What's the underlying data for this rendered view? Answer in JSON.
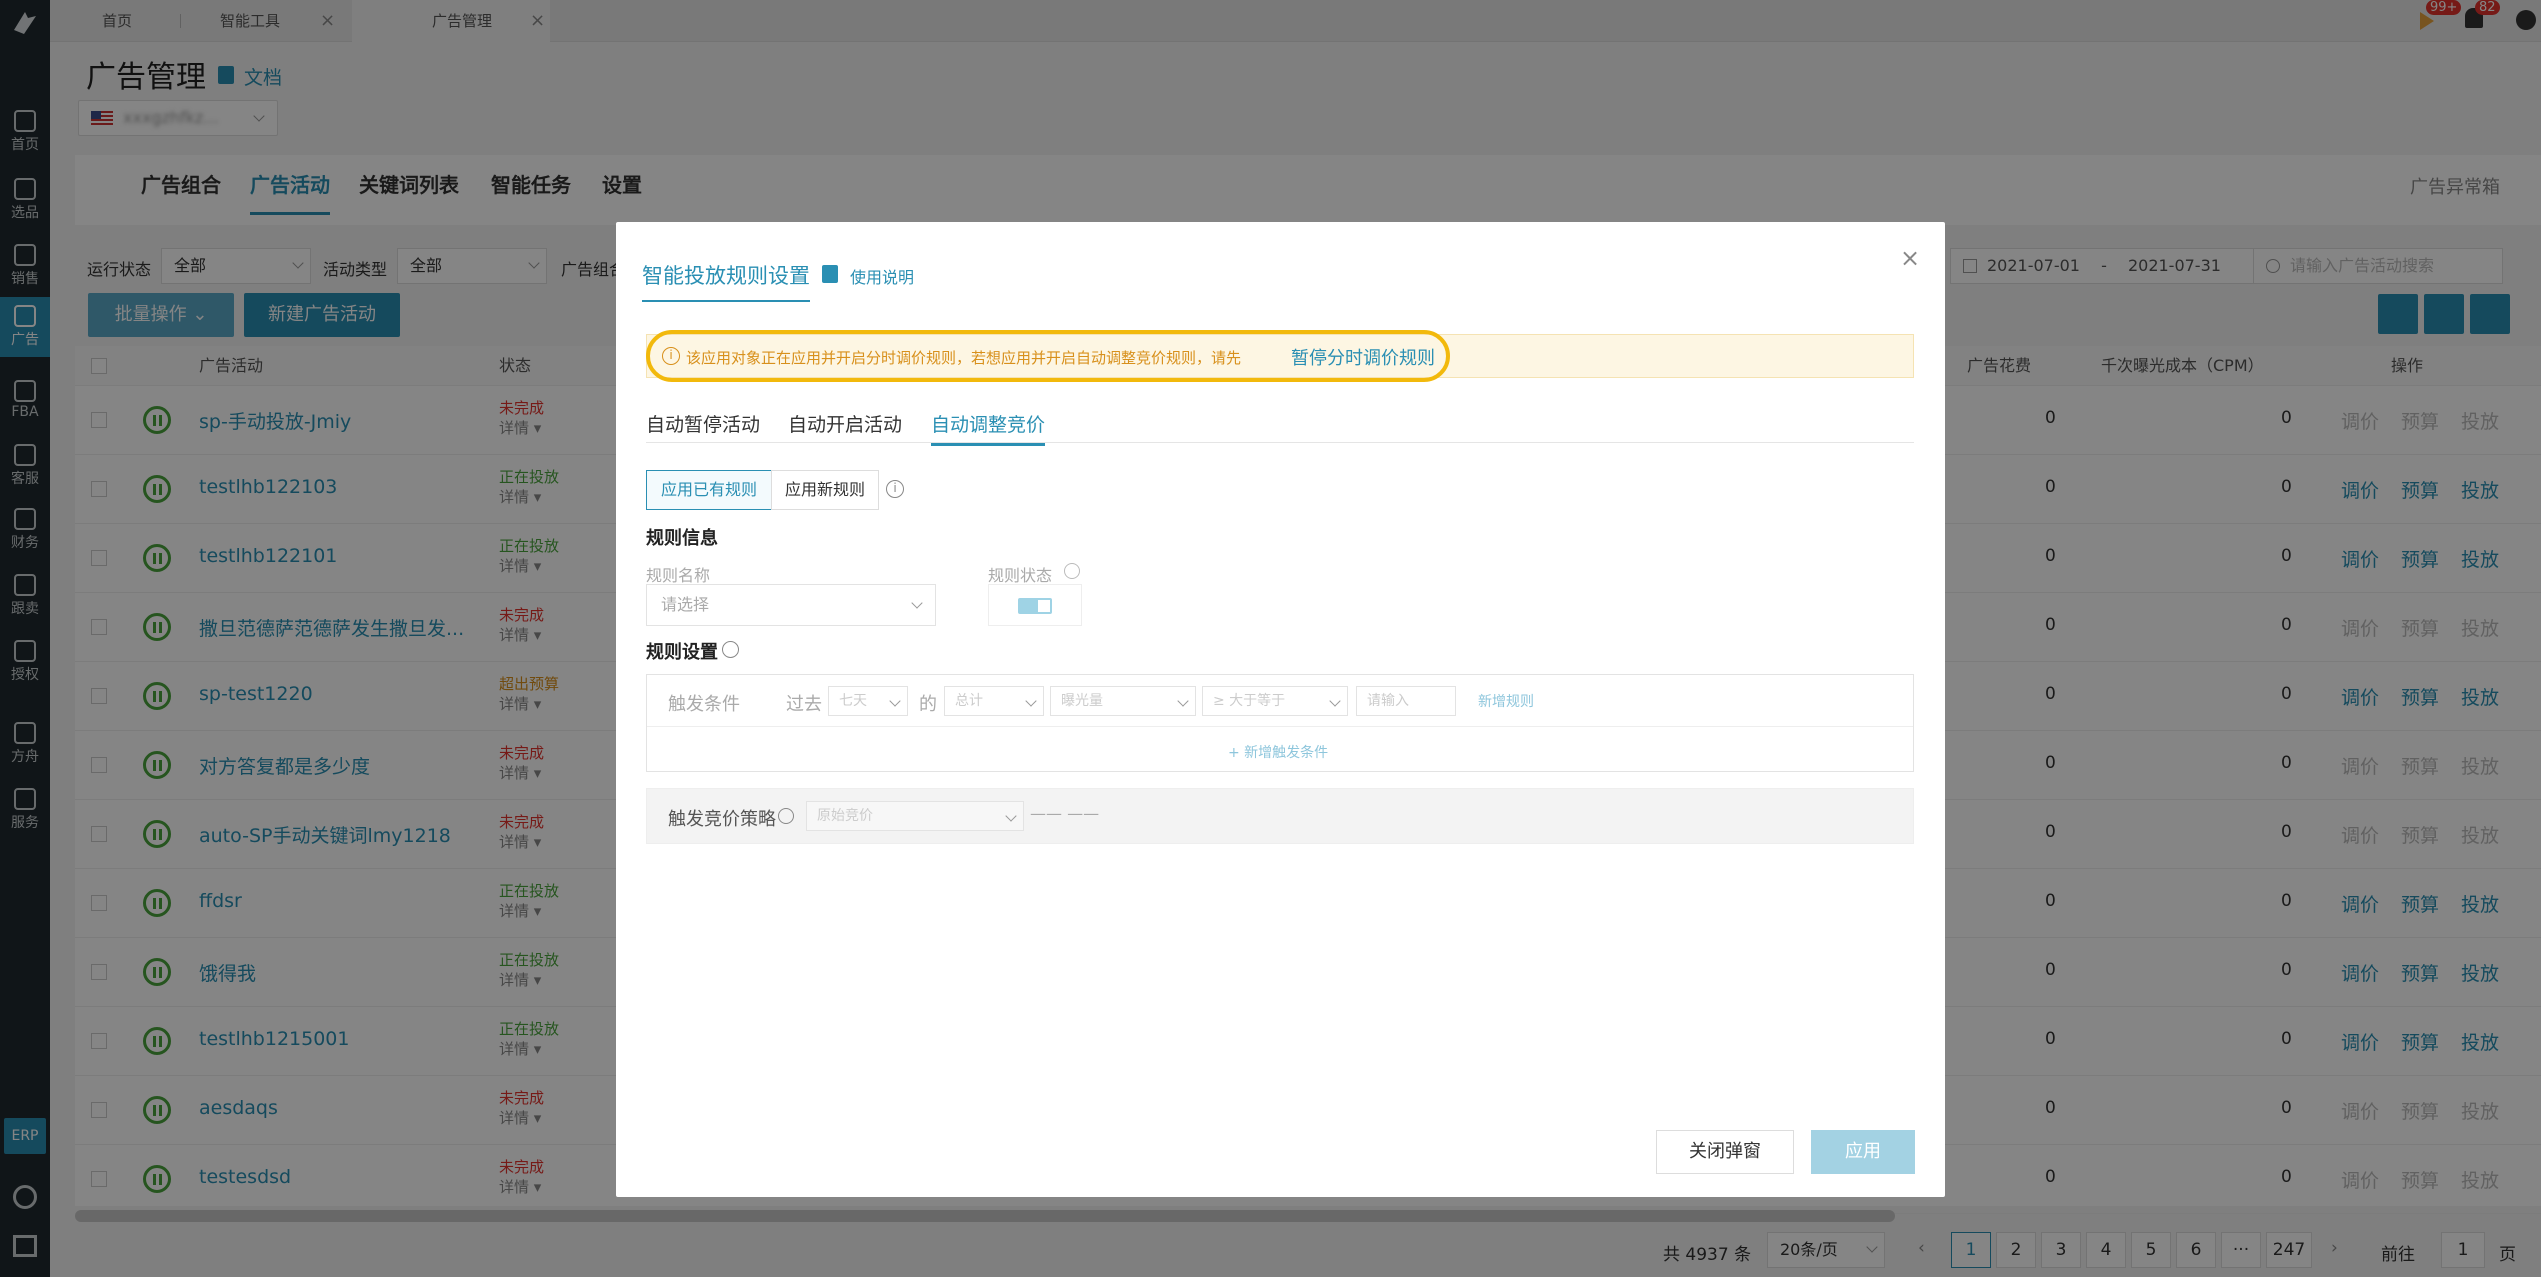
{
  "sidebar": {
    "items": [
      {
        "label": "首页",
        "icon": "home-icon"
      },
      {
        "label": "选品",
        "icon": "search-icon"
      },
      {
        "label": "销售",
        "icon": "chart-line-icon"
      },
      {
        "label": "广告",
        "icon": "ad-icon"
      },
      {
        "label": "FBA",
        "icon": "box-icon"
      },
      {
        "label": "客服",
        "icon": "chart-bar-icon"
      },
      {
        "label": "财务",
        "icon": "dollar-icon"
      },
      {
        "label": "跟卖",
        "icon": "pie-icon"
      },
      {
        "label": "授权",
        "icon": "shield-icon"
      },
      {
        "label": "方舟",
        "icon": "ark-icon"
      },
      {
        "label": "服务",
        "icon": "briefcase-icon"
      }
    ],
    "erp_label": "ERP"
  },
  "tabs": [
    "首页",
    "智能工具",
    "广告管理"
  ],
  "header": {
    "notification_badge_1": "99+",
    "notification_badge_2": "82"
  },
  "page": {
    "title": "广告管理",
    "doc_link": "文档",
    "store_name": "xxxgzhfkz..."
  },
  "subnav": {
    "items": [
      "广告组合",
      "广告活动",
      "关键词列表",
      "智能任务",
      "设置"
    ],
    "active": "广告活动",
    "right_link": "广告异常箱"
  },
  "filters": {
    "run_status_label": "运行状态",
    "run_status_value": "全部",
    "campaign_type_label": "活动类型",
    "campaign_type_value": "全部",
    "ad_group_label": "广告组合",
    "date_start": "2021-07-01",
    "date_sep": "-",
    "date_end": "2021-07-31",
    "search_placeholder": "请输入广告活动搜索",
    "batch_btn": "批量操作",
    "new_btn": "新建广告活动"
  },
  "table": {
    "headers": {
      "campaign": "广告活动",
      "status": "状态",
      "spend": "广告花费",
      "cpm": "千次曝光成本（CPM）",
      "ops": "操作"
    },
    "detail_label": "详情",
    "op_labels": [
      "调价",
      "预算",
      "投放"
    ],
    "rows": [
      {
        "name": "sp-手动投放-Jmiy",
        "status": "未完成",
        "status_color": "#e2322d",
        "spend": "0",
        "cpm": "0",
        "ops_active": false
      },
      {
        "name": "testlhb122103",
        "status": "正在投放",
        "status_color": "#4aa43d",
        "spend": "0",
        "cpm": "0",
        "ops_active": true
      },
      {
        "name": "testlhb122101",
        "status": "正在投放",
        "status_color": "#4aa43d",
        "spend": "0",
        "cpm": "0",
        "ops_active": true
      },
      {
        "name": "撒旦范德萨范德萨发生撒旦发...",
        "status": "未完成",
        "status_color": "#e2322d",
        "spend": "0",
        "cpm": "0",
        "ops_active": false
      },
      {
        "name": "sp-test1220",
        "status": "超出预算",
        "status_color": "#d8901b",
        "spend": "0",
        "cpm": "0",
        "ops_active": true
      },
      {
        "name": "对方答复都是多少度",
        "status": "未完成",
        "status_color": "#e2322d",
        "spend": "0",
        "cpm": "0",
        "ops_active": false
      },
      {
        "name": "auto-SP手动关键词lmy1218",
        "status": "未完成",
        "status_color": "#e2322d",
        "spend": "0",
        "cpm": "0",
        "ops_active": false
      },
      {
        "name": "ffdsr",
        "status": "正在投放",
        "status_color": "#4aa43d",
        "spend": "0",
        "cpm": "0",
        "ops_active": true
      },
      {
        "name": "饿得我",
        "status": "正在投放",
        "status_color": "#4aa43d",
        "spend": "0",
        "cpm": "0",
        "ops_active": true
      },
      {
        "name": "testlhb1215001",
        "status": "正在投放",
        "status_color": "#4aa43d",
        "spend": "0",
        "cpm": "0",
        "ops_active": true
      },
      {
        "name": "aesdaqs",
        "status": "未完成",
        "status_color": "#e2322d",
        "spend": "0",
        "cpm": "0",
        "ops_active": false
      },
      {
        "name": "testesdsd",
        "status": "未完成",
        "status_color": "#e2322d",
        "spend": "0",
        "cpm": "0",
        "ops_active": false
      }
    ]
  },
  "pagination": {
    "total": "共 4937 条",
    "page_size": "20条/页",
    "pages": [
      "1",
      "2",
      "3",
      "4",
      "5",
      "6",
      "···",
      "247"
    ],
    "goto_label": "前往",
    "goto_value": "1",
    "page_suffix": "页"
  },
  "modal": {
    "title": "智能投放规则设置",
    "help_link": "使用说明",
    "warning_text": "该应用对象正在应用并开启分时调价规则，若想应用并开启自动调整竞价规则，请先",
    "warning_link": "暂停分时调价规则",
    "tabs": [
      "自动暂停活动",
      "自动开启活动",
      "自动调整竞价"
    ],
    "active_tab": "自动调整竞价",
    "rule_toggle": [
      "应用已有规则",
      "应用新规则"
    ],
    "rule_info_heading": "规则信息",
    "rule_name_label": "规则名称",
    "rule_name_placeholder": "请选择",
    "rule_status_label": "规则状态",
    "rule_settings_heading": "规则设置",
    "trigger_label": "触发条件",
    "past_label": "过去",
    "days_placeholder": "七天",
    "de_label": "的",
    "sum_placeholder": "总计",
    "metric_placeholder": "曝光量",
    "compare_placeholder": "≥ 大于等于",
    "value_placeholder": "请输入",
    "add_rule_link": "新增规则",
    "add_condition_link": "+ 新增触发条件",
    "strategy_label": "触发竞价策略",
    "strategy_placeholder": "原始竞价",
    "strategy_dashes": "—— ——",
    "close_btn": "关闭弹窗",
    "apply_btn": "应用"
  }
}
